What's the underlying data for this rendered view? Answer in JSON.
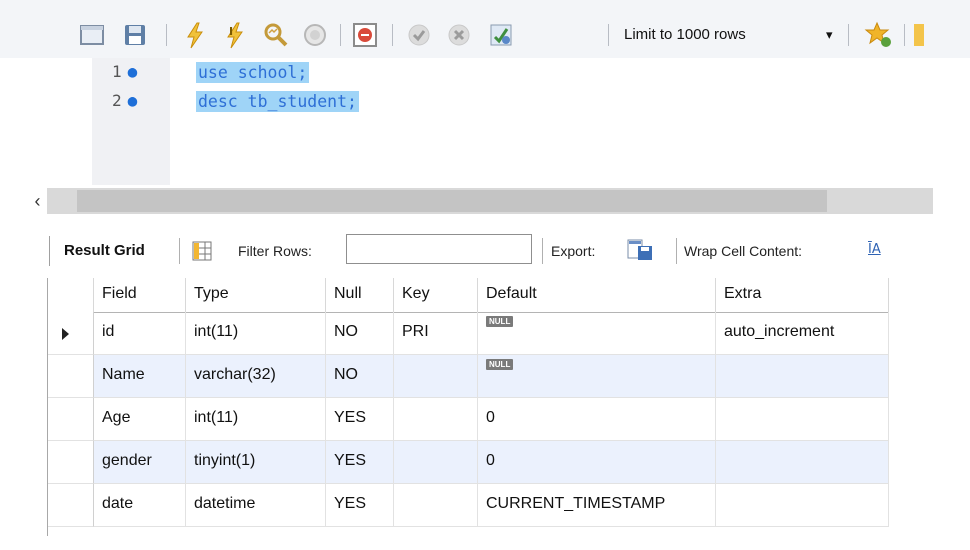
{
  "toolbar": {
    "limit_label": "Limit to 1000 rows",
    "icons": [
      "open-file-icon",
      "save-icon",
      "execute-icon",
      "execute-current-icon",
      "explain-icon",
      "stop-icon",
      "toggle-error-icon",
      "commit-icon",
      "rollback-icon",
      "autocommit-icon",
      "beautify-icon"
    ]
  },
  "editor": {
    "lines": [
      {
        "number": "1",
        "code": "use school;"
      },
      {
        "number": "2",
        "code": "desc tb_student;"
      }
    ]
  },
  "result_toolbar": {
    "result_grid_label": "Result Grid",
    "filter_rows_label": "Filter Rows:",
    "filter_rows_value": "",
    "export_label": "Export:",
    "wrap_label": "Wrap Cell Content:"
  },
  "grid": {
    "columns": [
      "Field",
      "Type",
      "Null",
      "Key",
      "Default",
      "Extra"
    ],
    "null_label": "NULL",
    "rows": [
      {
        "field": "id",
        "type": "int(11)",
        "null": "NO",
        "key": "PRI",
        "default": null,
        "extra": "auto_increment",
        "selected": true
      },
      {
        "field": "Name",
        "type": "varchar(32)",
        "null": "NO",
        "key": "",
        "default": null,
        "extra": "",
        "selected": false
      },
      {
        "field": "Age",
        "type": "int(11)",
        "null": "YES",
        "key": "",
        "default": "0",
        "extra": "",
        "selected": false
      },
      {
        "field": "gender",
        "type": "tinyint(1)",
        "null": "YES",
        "key": "",
        "default": "0",
        "extra": "",
        "selected": false
      },
      {
        "field": "date",
        "type": "datetime",
        "null": "YES",
        "key": "",
        "default": "CURRENT_TIMESTAMP",
        "extra": "",
        "selected": false
      }
    ]
  },
  "colors": {
    "selection": "#9fd4f7",
    "code_text": "#2e6fd6",
    "alt_row": "#ebf1fd",
    "toolbar_bg": "#f3f5f8"
  }
}
